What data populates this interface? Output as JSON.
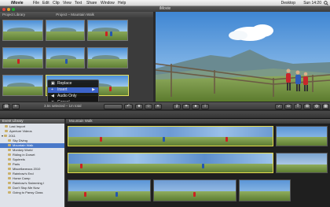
{
  "menubar": {
    "app": "iMovie",
    "items": [
      "File",
      "Edit",
      "Clip",
      "View",
      "Text",
      "Share",
      "Window",
      "Help"
    ],
    "clock": "Sun 14:20",
    "user": "Desktop"
  },
  "window": {
    "title": "iMovie"
  },
  "project_pane": {
    "library_label": "Project Library",
    "project_title": "Project – Mountain Walk",
    "status": "3.5s selected – 1m total"
  },
  "context_menu": {
    "items": [
      {
        "label": "Replace",
        "icon": "replace-icon"
      },
      {
        "label": "Insert",
        "icon": "insert-icon",
        "highlighted": true
      },
      {
        "label": "Audio Only",
        "icon": "audio-icon"
      },
      {
        "label": "Cancel",
        "icon": "cancel-icon"
      }
    ]
  },
  "event_library": {
    "title": "Event Library",
    "items": [
      {
        "label": "Last Import",
        "indent": 1
      },
      {
        "label": "Aperture Videos",
        "indent": 1
      },
      {
        "label": "2011",
        "indent": 0
      },
      {
        "label": "Sky Diving",
        "indent": 2
      },
      {
        "label": "Mountain Walk",
        "indent": 2,
        "selected": true
      },
      {
        "label": "Monkey World",
        "indent": 2
      },
      {
        "label": "Riding in Dorset",
        "indent": 2
      },
      {
        "label": "Squirrels",
        "indent": 2
      },
      {
        "label": "Paris",
        "indent": 2
      },
      {
        "label": "Miscellaneous 2010",
        "indent": 2
      },
      {
        "label": "Rainbow's End",
        "indent": 2
      },
      {
        "label": "Horse Camp",
        "indent": 2
      },
      {
        "label": "Rainbow's Swimming I",
        "indent": 2
      },
      {
        "label": "Don't Stop Me Now",
        "indent": 2
      },
      {
        "label": "Going to Pansy Class",
        "indent": 2
      }
    ]
  },
  "events_pane": {
    "title": "Mountain Walk"
  },
  "colors": {
    "accent": "#e7e05a",
    "selection": "#4a79c9",
    "highlight": "#3d64c9"
  }
}
